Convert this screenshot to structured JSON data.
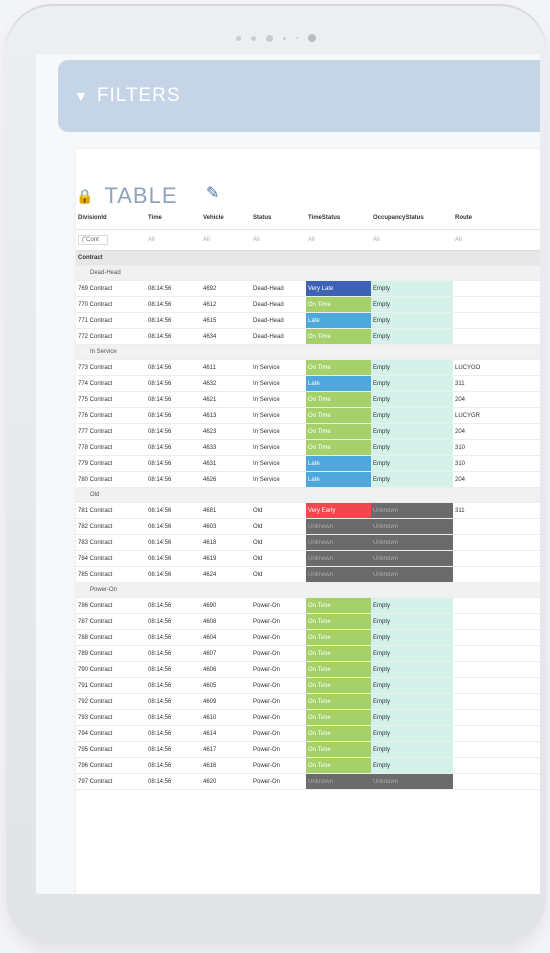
{
  "filters": {
    "label": "FILTERS"
  },
  "table_title": "TABLE",
  "columns": [
    "DivisionId",
    "Time",
    "Vehicle",
    "Status",
    "TimeStatus",
    "OccupancyStatus",
    "Route"
  ],
  "filter_row": {
    "division": "(\"Cont",
    "values": [
      "All",
      "All",
      "All",
      "All",
      "All",
      "All"
    ]
  },
  "group_label": "Contract",
  "subgroups": [
    {
      "label": "Dead-Head",
      "rows": [
        [
          "769 Contract",
          "08:14:56",
          "4692",
          "Dead-Head",
          "Very Late",
          "Empty",
          ""
        ],
        [
          "770 Contract",
          "08:14:56",
          "4612",
          "Dead-Head",
          "On Time",
          "Empty",
          ""
        ],
        [
          "771 Contract",
          "08:14:56",
          "4615",
          "Dead-Head",
          "Late",
          "Empty",
          ""
        ],
        [
          "772 Contract",
          "08:14:56",
          "4634",
          "Dead-Head",
          "On Time",
          "Empty",
          ""
        ]
      ]
    },
    {
      "label": "In Service",
      "rows": [
        [
          "773 Contract",
          "08:14:56",
          "4611",
          "In Service",
          "On Time",
          "Empty",
          "LUCYGO"
        ],
        [
          "774 Contract",
          "08:14:56",
          "4632",
          "In Service",
          "Late",
          "Empty",
          "311"
        ],
        [
          "775 Contract",
          "08:14:56",
          "4621",
          "In Service",
          "On Time",
          "Empty",
          "204"
        ],
        [
          "776 Contract",
          "08:14:56",
          "4613",
          "In Service",
          "On Time",
          "Empty",
          "LUCYGR"
        ],
        [
          "777 Contract",
          "08:14:56",
          "4623",
          "In Service",
          "On Time",
          "Empty",
          "204"
        ],
        [
          "778 Contract",
          "08:14:56",
          "4633",
          "In Service",
          "On Time",
          "Empty",
          "310"
        ],
        [
          "779 Contract",
          "08:14:56",
          "4631",
          "In Service",
          "Late",
          "Empty",
          "310"
        ],
        [
          "780 Contract",
          "08:14:56",
          "4626",
          "In Service",
          "Late",
          "Empty",
          "204"
        ]
      ]
    },
    {
      "label": "Old",
      "rows": [
        [
          "781 Contract",
          "08:14:56",
          "4681",
          "Old",
          "Very Early",
          "Unknown",
          "311"
        ],
        [
          "782 Contract",
          "08:14:56",
          "4603",
          "Old",
          "Unknown",
          "Unknown",
          ""
        ],
        [
          "783 Contract",
          "08:14:56",
          "4618",
          "Old",
          "Unknown",
          "Unknown",
          ""
        ],
        [
          "784 Contract",
          "08:14:56",
          "4619",
          "Old",
          "Unknown",
          "Unknown",
          ""
        ],
        [
          "785 Contract",
          "08:14:56",
          "4624",
          "Old",
          "Unknown",
          "Unknown",
          ""
        ]
      ]
    },
    {
      "label": "Power-On",
      "rows": [
        [
          "786 Contract",
          "08:14:56",
          "4690",
          "Power-On",
          "On Time",
          "Empty",
          ""
        ],
        [
          "787 Contract",
          "08:14:56",
          "4608",
          "Power-On",
          "On Time",
          "Empty",
          ""
        ],
        [
          "788 Contract",
          "08:14:56",
          "4604",
          "Power-On",
          "On Time",
          "Empty",
          ""
        ],
        [
          "789 Contract",
          "08:14:56",
          "4607",
          "Power-On",
          "On Time",
          "Empty",
          ""
        ],
        [
          "790 Contract",
          "08:14:56",
          "4606",
          "Power-On",
          "On Time",
          "Empty",
          ""
        ],
        [
          "791 Contract",
          "08:14:56",
          "4605",
          "Power-On",
          "On Time",
          "Empty",
          ""
        ],
        [
          "792 Contract",
          "08:14:56",
          "4609",
          "Power-On",
          "On Time",
          "Empty",
          ""
        ],
        [
          "793 Contract",
          "08:14:56",
          "4610",
          "Power-On",
          "On Time",
          "Empty",
          ""
        ],
        [
          "794 Contract",
          "08:14:56",
          "4614",
          "Power-On",
          "On Time",
          "Empty",
          ""
        ],
        [
          "795 Contract",
          "08:14:56",
          "4617",
          "Power-On",
          "On Time",
          "Empty",
          ""
        ],
        [
          "796 Contract",
          "08:14:56",
          "4616",
          "Power-On",
          "On Time",
          "Empty",
          ""
        ],
        [
          "797 Contract",
          "08:14:56",
          "4620",
          "Power-On",
          "Unknown",
          "Unknown",
          ""
        ]
      ]
    }
  ],
  "colors": {
    "Very Early": "#f0484e",
    "Very Late": "#3d63b4",
    "On Time": "#a5d06a",
    "Late": "#4ea8dc",
    "Unknown": "#6b6b6b",
    "Empty": "#d4f1ea"
  }
}
